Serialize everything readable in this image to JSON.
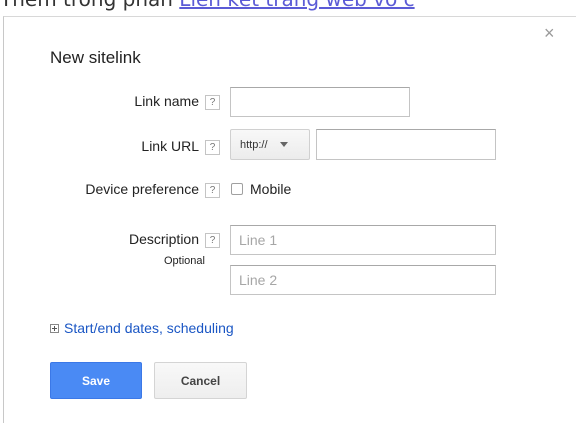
{
  "background": {
    "text_prefix": "Thêm trong phần ",
    "link_text": "Liên kết trang web vớ c"
  },
  "dialog": {
    "title": "New sitelink",
    "close_glyph": "×",
    "help_glyph": "?",
    "fields": {
      "link_name": {
        "label": "Link name",
        "value": ""
      },
      "link_url": {
        "label": "Link URL",
        "protocol": "http://",
        "value": ""
      },
      "device_preference": {
        "label": "Device preference",
        "option_label": "Mobile",
        "checked": false
      },
      "description": {
        "label": "Description",
        "optional_label": "Optional",
        "line1_placeholder": "Line 1",
        "line2_placeholder": "Line 2"
      }
    },
    "expand_link": "Start/end dates, scheduling",
    "buttons": {
      "save": "Save",
      "cancel": "Cancel"
    },
    "colors": {
      "save_bg": "#4a8af4",
      "link": "#1a56c4"
    }
  }
}
